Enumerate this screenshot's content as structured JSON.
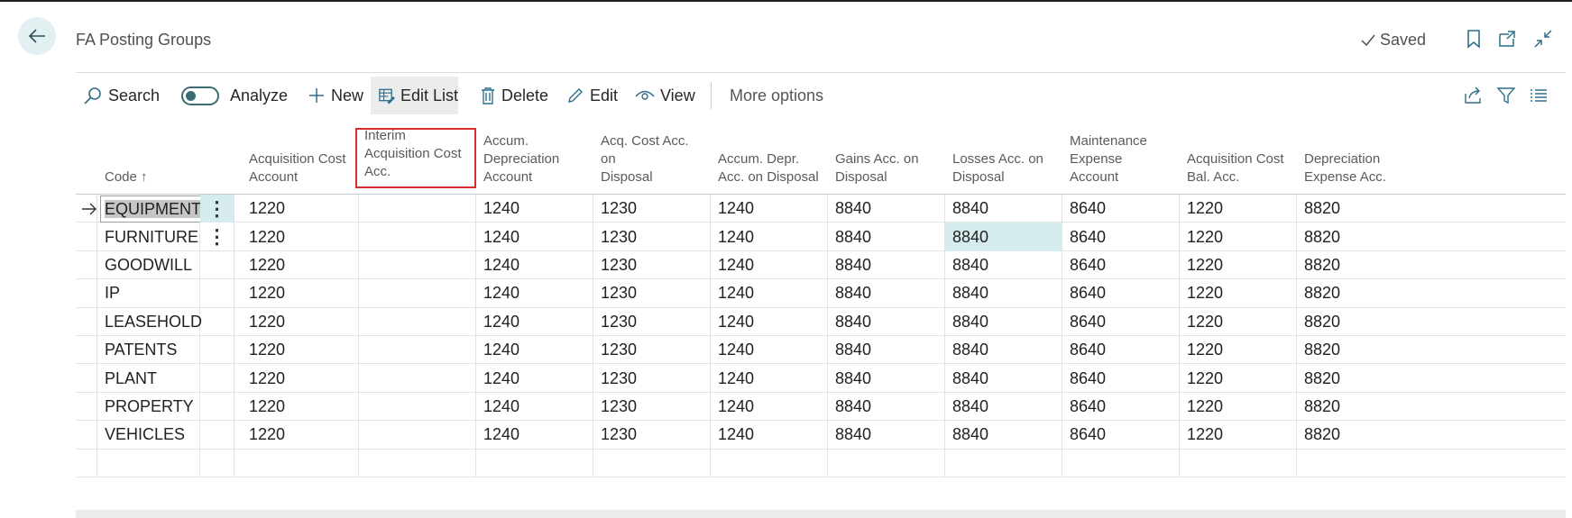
{
  "page": {
    "title": "FA Posting Groups",
    "status": "Saved"
  },
  "icons": {
    "back": "arrow-left-icon",
    "bookmark": "bookmark-icon",
    "open_new": "open-in-new-window-icon",
    "collapse": "collapse-icon",
    "share": "share-icon",
    "filter": "filter-icon",
    "list": "list-view-icon"
  },
  "toolbar": {
    "search": "Search",
    "analyze": "Analyze",
    "new": "New",
    "edit_list": "Edit List",
    "delete": "Delete",
    "edit": "Edit",
    "view": "View",
    "more_options": "More options"
  },
  "columns": [
    {
      "key": "code",
      "lines": [
        "Code ↑"
      ]
    },
    {
      "key": "acq_cost",
      "lines": [
        "Acquisition Cost",
        "Account"
      ]
    },
    {
      "key": "interim",
      "lines": [
        "Interim",
        "Acquisition Cost",
        "Acc."
      ],
      "highlighted": true
    },
    {
      "key": "accum_dep",
      "lines": [
        "Accum.",
        "Depreciation",
        "Account"
      ]
    },
    {
      "key": "acq_disp",
      "lines": [
        "Acq. Cost Acc. on",
        "Disposal"
      ]
    },
    {
      "key": "accum_disp",
      "lines": [
        "Accum. Depr.",
        "Acc. on Disposal"
      ]
    },
    {
      "key": "gains",
      "lines": [
        "Gains Acc. on",
        "Disposal"
      ]
    },
    {
      "key": "losses",
      "lines": [
        "Losses Acc. on",
        "Disposal"
      ]
    },
    {
      "key": "maint",
      "lines": [
        "Maintenance",
        "Expense Account"
      ]
    },
    {
      "key": "acq_bal",
      "lines": [
        "Acquisition Cost",
        "Bal. Acc."
      ]
    },
    {
      "key": "dep_exp",
      "lines": [
        "Depreciation",
        "Expense Acc."
      ]
    }
  ],
  "rows": [
    {
      "code": "EQUIPMENT",
      "acq_cost": "1220",
      "interim": "",
      "accum_dep": "1240",
      "acq_disp": "1230",
      "accum_disp": "1240",
      "gains": "8840",
      "losses": "8840",
      "maint": "8640",
      "acq_bal": "1220",
      "dep_exp": "8820"
    },
    {
      "code": "FURNITURE",
      "acq_cost": "1220",
      "interim": "",
      "accum_dep": "1240",
      "acq_disp": "1230",
      "accum_disp": "1240",
      "gains": "8840",
      "losses": "8840",
      "maint": "8640",
      "acq_bal": "1220",
      "dep_exp": "8820"
    },
    {
      "code": "GOODWILL",
      "acq_cost": "1220",
      "interim": "",
      "accum_dep": "1240",
      "acq_disp": "1230",
      "accum_disp": "1240",
      "gains": "8840",
      "losses": "8840",
      "maint": "8640",
      "acq_bal": "1220",
      "dep_exp": "8820"
    },
    {
      "code": "IP",
      "acq_cost": "1220",
      "interim": "",
      "accum_dep": "1240",
      "acq_disp": "1230",
      "accum_disp": "1240",
      "gains": "8840",
      "losses": "8840",
      "maint": "8640",
      "acq_bal": "1220",
      "dep_exp": "8820"
    },
    {
      "code": "LEASEHOLD",
      "acq_cost": "1220",
      "interim": "",
      "accum_dep": "1240",
      "acq_disp": "1230",
      "accum_disp": "1240",
      "gains": "8840",
      "losses": "8840",
      "maint": "8640",
      "acq_bal": "1220",
      "dep_exp": "8820"
    },
    {
      "code": "PATENTS",
      "acq_cost": "1220",
      "interim": "",
      "accum_dep": "1240",
      "acq_disp": "1230",
      "accum_disp": "1240",
      "gains": "8840",
      "losses": "8840",
      "maint": "8640",
      "acq_bal": "1220",
      "dep_exp": "8820"
    },
    {
      "code": "PLANT",
      "acq_cost": "1220",
      "interim": "",
      "accum_dep": "1240",
      "acq_disp": "1230",
      "accum_disp": "1240",
      "gains": "8840",
      "losses": "8840",
      "maint": "8640",
      "acq_bal": "1220",
      "dep_exp": "8820"
    },
    {
      "code": "PROPERTY",
      "acq_cost": "1220",
      "interim": "",
      "accum_dep": "1240",
      "acq_disp": "1230",
      "accum_disp": "1240",
      "gains": "8840",
      "losses": "8840",
      "maint": "8640",
      "acq_bal": "1220",
      "dep_exp": "8820"
    },
    {
      "code": "VEHICLES",
      "acq_cost": "1220",
      "interim": "",
      "accum_dep": "1240",
      "acq_disp": "1230",
      "accum_disp": "1240",
      "gains": "8840",
      "losses": "8840",
      "maint": "8640",
      "acq_bal": "1220",
      "dep_exp": "8820"
    }
  ],
  "current_row": 0,
  "selected_cell": {
    "row": 1,
    "column": "losses"
  },
  "colors": {
    "accent": "#3a6d73",
    "selection": "#d6ecee",
    "highlight_border": "#d32f2f"
  }
}
